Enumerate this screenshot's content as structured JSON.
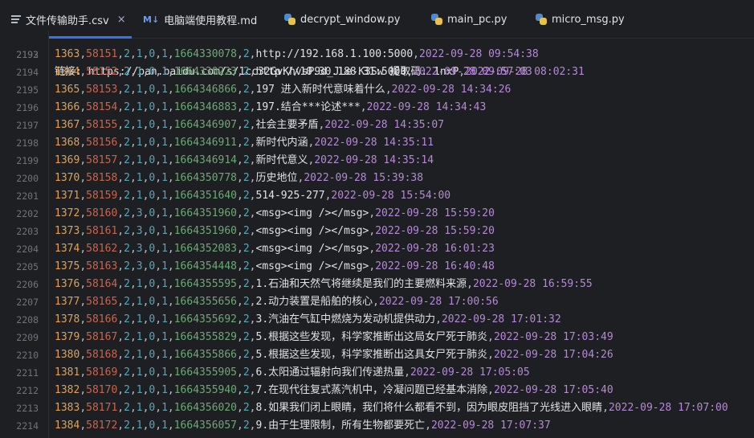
{
  "tabs": [
    {
      "label": "文件传输助手.csv",
      "icon": "csv-file-icon",
      "active": true,
      "close": "×"
    },
    {
      "label": "电脑端使用教程.md",
      "icon": "markdown-file-icon",
      "active": false,
      "md_badge": "M↓"
    },
    {
      "label": "decrypt_window.py",
      "icon": "python-file-icon",
      "active": false
    },
    {
      "label": "main_pc.py",
      "icon": "python-file-icon",
      "active": false
    },
    {
      "label": "micro_msg.py",
      "icon": "python-file-icon",
      "active": false
    }
  ],
  "partial_line": {
    "line": "2192",
    "text": "链接: https://pan.baidu.com/s/1cc32GvKhvsP9d_JLe-K3Sw 提取码: 1nxP",
    "date": "2022-09-28 08:02:31"
  },
  "lines": [
    {
      "ln": "2193",
      "id": "1363",
      "seq": "58151",
      "a": "2",
      "b": "1",
      "c": "0",
      "d": "1",
      "ts": "1664330078",
      "e": "2",
      "text": "http://192.168.1.100:5000",
      "date": "2022-09-28 09:54:38"
    },
    {
      "ln": "2194",
      "id": "1364",
      "seq": "58152",
      "a": "2",
      "b": "1",
      "c": "0",
      "d": "1",
      "ts": "1664330223",
      "e": "2",
      "text": "http://10.30.188.31:5000",
      "date": "2022-09-28 09:57:03"
    },
    {
      "ln": "2195",
      "id": "1365",
      "seq": "58153",
      "a": "2",
      "b": "1",
      "c": "0",
      "d": "1",
      "ts": "1664346866",
      "e": "2",
      "text": "197 进入新时代意味着什么",
      "date": "2022-09-28 14:34:26"
    },
    {
      "ln": "2196",
      "id": "1366",
      "seq": "58154",
      "a": "2",
      "b": "1",
      "c": "0",
      "d": "1",
      "ts": "1664346883",
      "e": "2",
      "text": "197.结合***论述***",
      "date": "2022-09-28 14:34:43"
    },
    {
      "ln": "2197",
      "id": "1367",
      "seq": "58155",
      "a": "2",
      "b": "1",
      "c": "0",
      "d": "1",
      "ts": "1664346907",
      "e": "2",
      "text": "社会主要矛盾",
      "date": "2022-09-28 14:35:07"
    },
    {
      "ln": "2198",
      "id": "1368",
      "seq": "58156",
      "a": "2",
      "b": "1",
      "c": "0",
      "d": "1",
      "ts": "1664346911",
      "e": "2",
      "text": "新时代内涵",
      "date": "2022-09-28 14:35:11"
    },
    {
      "ln": "2199",
      "id": "1369",
      "seq": "58157",
      "a": "2",
      "b": "1",
      "c": "0",
      "d": "1",
      "ts": "1664346914",
      "e": "2",
      "text": "新时代意义",
      "date": "2022-09-28 14:35:14"
    },
    {
      "ln": "2200",
      "id": "1370",
      "seq": "58158",
      "a": "2",
      "b": "1",
      "c": "0",
      "d": "1",
      "ts": "1664350778",
      "e": "2",
      "text": "历史地位",
      "date": "2022-09-28 15:39:38"
    },
    {
      "ln": "2201",
      "id": "1371",
      "seq": "58159",
      "a": "2",
      "b": "1",
      "c": "0",
      "d": "1",
      "ts": "1664351640",
      "e": "2",
      "text": "514-925-277",
      "date": "2022-09-28 15:54:00"
    },
    {
      "ln": "2202",
      "id": "1372",
      "seq": "58160",
      "a": "2",
      "b": "3",
      "c": "0",
      "d": "1",
      "ts": "1664351960",
      "e": "2",
      "text": "<msg><img /></msg>",
      "date": "2022-09-28 15:59:20"
    },
    {
      "ln": "2203",
      "id": "1373",
      "seq": "58161",
      "a": "2",
      "b": "3",
      "c": "0",
      "d": "1",
      "ts": "1664351960",
      "e": "2",
      "text": "<msg><img /></msg>",
      "date": "2022-09-28 15:59:20"
    },
    {
      "ln": "2204",
      "id": "1374",
      "seq": "58162",
      "a": "2",
      "b": "3",
      "c": "0",
      "d": "1",
      "ts": "1664352083",
      "e": "2",
      "text": "<msg><img /></msg>",
      "date": "2022-09-28 16:01:23"
    },
    {
      "ln": "2205",
      "id": "1375",
      "seq": "58163",
      "a": "2",
      "b": "3",
      "c": "0",
      "d": "1",
      "ts": "1664354448",
      "e": "2",
      "text": "<msg><img /></msg>",
      "date": "2022-09-28 16:40:48"
    },
    {
      "ln": "2206",
      "id": "1376",
      "seq": "58164",
      "a": "2",
      "b": "1",
      "c": "0",
      "d": "1",
      "ts": "1664355595",
      "e": "2",
      "text": "1.石油和天然气将继续是我们的主要燃料来源",
      "date": "2022-09-28 16:59:55"
    },
    {
      "ln": "2207",
      "id": "1377",
      "seq": "58165",
      "a": "2",
      "b": "1",
      "c": "0",
      "d": "1",
      "ts": "1664355656",
      "e": "2",
      "text": "2.动力装置是船舶的核心",
      "date": "2022-09-28 17:00:56"
    },
    {
      "ln": "2208",
      "id": "1378",
      "seq": "58166",
      "a": "2",
      "b": "1",
      "c": "0",
      "d": "1",
      "ts": "1664355692",
      "e": "2",
      "text": "3.汽油在气缸中燃烧为发动机提供动力",
      "date": "2022-09-28 17:01:32"
    },
    {
      "ln": "2209",
      "id": "1379",
      "seq": "58167",
      "a": "2",
      "b": "1",
      "c": "0",
      "d": "1",
      "ts": "1664355829",
      "e": "2",
      "text": "5.根据这些发现，科学家推断出这局女尸死于肺炎",
      "date": "2022-09-28 17:03:49"
    },
    {
      "ln": "2210",
      "id": "1380",
      "seq": "58168",
      "a": "2",
      "b": "1",
      "c": "0",
      "d": "1",
      "ts": "1664355866",
      "e": "2",
      "text": "5.根据这些发现，科学家推断出这具女尸死于肺炎",
      "date": "2022-09-28 17:04:26"
    },
    {
      "ln": "2211",
      "id": "1381",
      "seq": "58169",
      "a": "2",
      "b": "1",
      "c": "0",
      "d": "1",
      "ts": "1664355905",
      "e": "2",
      "text": "6.太阳通过辐射向我们传递热量",
      "date": "2022-09-28 17:05:05"
    },
    {
      "ln": "2212",
      "id": "1382",
      "seq": "58170",
      "a": "2",
      "b": "1",
      "c": "0",
      "d": "1",
      "ts": "1664355940",
      "e": "2",
      "text": "7.在现代往复式蒸汽机中，冷凝问题已经基本消除",
      "date": "2022-09-28 17:05:40"
    },
    {
      "ln": "2213",
      "id": "1383",
      "seq": "58171",
      "a": "2",
      "b": "1",
      "c": "0",
      "d": "1",
      "ts": "1664356020",
      "e": "2",
      "text": "8.如果我们闭上眼睛，我们将什么都看不到，因为眼皮阻挡了光线进入眼睛",
      "date": "2022-09-28 17:07:00"
    },
    {
      "ln": "2214",
      "id": "1384",
      "seq": "58172",
      "a": "2",
      "b": "1",
      "c": "0",
      "d": "1",
      "ts": "1664356057",
      "e": "2",
      "text": "9.由于生理限制，所有生物都要死亡",
      "date": "2022-09-28 17:07:37"
    }
  ],
  "colors": {
    "background": "#1e1f22",
    "line_number": "#6f737a",
    "field_id": "#e3a24f",
    "field_seq": "#c7664f",
    "field_small": "#56a8b8",
    "field_ts": "#6aab73",
    "field_date": "#b589d6",
    "field_text": "#dfe1e5",
    "tab_accent": "#3574f0"
  }
}
